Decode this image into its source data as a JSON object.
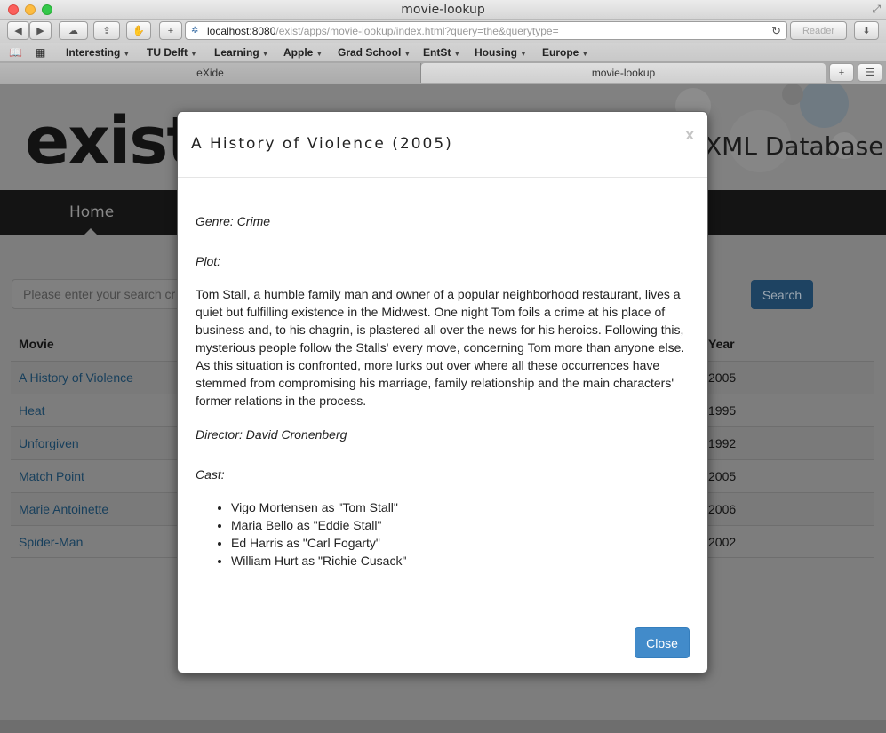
{
  "window": {
    "title": "movie-lookup"
  },
  "toolbar": {
    "address_host": "localhost:8080",
    "address_path": "/exist/apps/movie-lookup/index.html?query=the&querytype=",
    "reader_label": "Reader"
  },
  "bookmarks": [
    "Interesting",
    "TU Delft",
    "Learning",
    "Apple",
    "Grad School",
    "EntSt",
    "Housing",
    "Europe"
  ],
  "tabs": [
    {
      "label": "eXide"
    },
    {
      "label": "movie-lookup"
    }
  ],
  "header": {
    "logo_text": "exist",
    "tagline": "XML Database"
  },
  "nav": {
    "home": "Home"
  },
  "search": {
    "placeholder": "Please enter your search cr",
    "button": "Search"
  },
  "results": {
    "columns": {
      "movie": "Movie",
      "year": "Year"
    },
    "rows": [
      {
        "title": "A History of Violence",
        "year": "2005"
      },
      {
        "title": "Heat",
        "year": "1995"
      },
      {
        "title": "Unforgiven",
        "year": "1992"
      },
      {
        "title": "Match Point",
        "year": "2005"
      },
      {
        "title": "Marie Antoinette",
        "year": "2006"
      },
      {
        "title": "Spider-Man",
        "year": "2002"
      }
    ]
  },
  "modal": {
    "title": "A History of Violence (2005)",
    "close_x": "x",
    "genre": "Genre: Crime",
    "plot_label": "Plot:",
    "plot": "Tom Stall, a humble family man and owner of a popular neighborhood restaurant, lives a quiet but fulfilling existence in the Midwest. One night Tom foils a crime at his place of business and, to his chagrin, is plastered all over the news for his heroics. Following this, mysterious people follow the Stalls' every move, concerning Tom more than anyone else. As this situation is confronted, more lurks out over where all these occurrences have stemmed from compromising his marriage, family relationship and the main characters' former relations in the process.",
    "director": "Director: David Cronenberg",
    "cast_label": "Cast:",
    "cast": [
      "Vigo Mortensen as \"Tom Stall\"",
      "Maria Bello as \"Eddie Stall\"",
      "Ed Harris as \"Carl Fogarty\"",
      "William Hurt as \"Richie Cusack\""
    ],
    "close_button": "Close"
  }
}
